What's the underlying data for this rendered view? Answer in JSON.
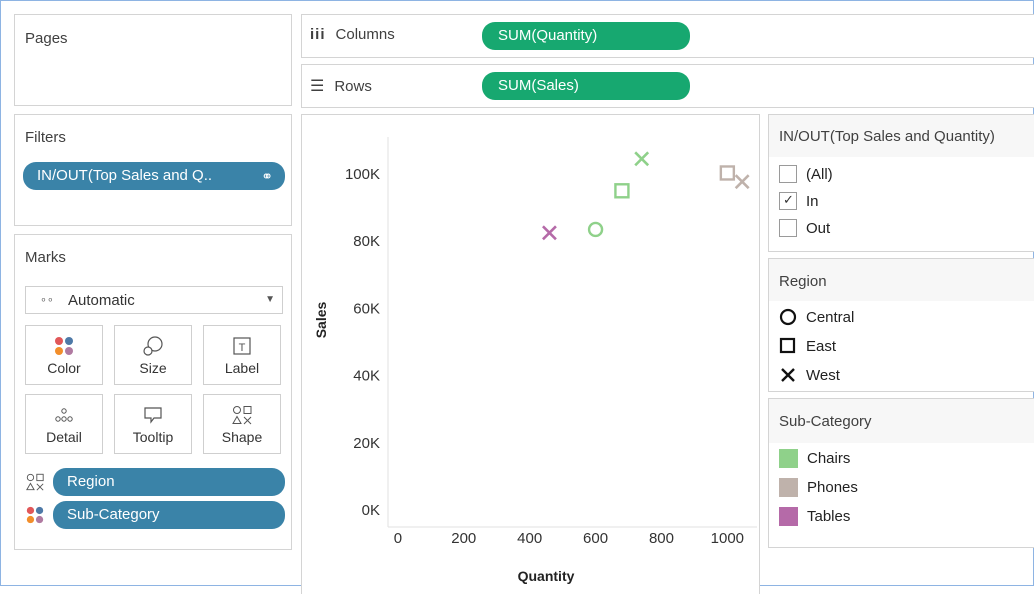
{
  "pages": {
    "title": "Pages"
  },
  "columns_shelf": {
    "label": "Columns",
    "pill": "SUM(Quantity)"
  },
  "rows_shelf": {
    "label": "Rows",
    "pill": "SUM(Sales)"
  },
  "filters": {
    "title": "Filters",
    "pill": "IN/OUT(Top Sales and Q.."
  },
  "marks": {
    "title": "Marks",
    "mark_type": "Automatic",
    "buttons": [
      {
        "label": "Color",
        "icon": "color-icon"
      },
      {
        "label": "Size",
        "icon": "size-icon"
      },
      {
        "label": "Label",
        "icon": "label-icon"
      },
      {
        "label": "Detail",
        "icon": "detail-icon"
      },
      {
        "label": "Tooltip",
        "icon": "tooltip-icon"
      },
      {
        "label": "Shape",
        "icon": "shape-icon"
      }
    ],
    "fields": [
      {
        "label": "Region",
        "icon": "shape-icon"
      },
      {
        "label": "Sub-Category",
        "icon": "color-icon"
      }
    ]
  },
  "inout_legend": {
    "title": "IN/OUT(Top Sales and Quantity)",
    "options": [
      {
        "label": "(All)",
        "checked": false
      },
      {
        "label": "In",
        "checked": true
      },
      {
        "label": "Out",
        "checked": false
      }
    ]
  },
  "region_legend": {
    "title": "Region",
    "items": [
      {
        "label": "Central",
        "shape": "circle"
      },
      {
        "label": "East",
        "shape": "square"
      },
      {
        "label": "West",
        "shape": "x"
      }
    ]
  },
  "subcategory_legend": {
    "title": "Sub-Category",
    "items": [
      {
        "label": "Chairs",
        "color": "#8fd18a"
      },
      {
        "label": "Phones",
        "color": "#bfb2ab"
      },
      {
        "label": "Tables",
        "color": "#b56aa8"
      }
    ]
  },
  "chart_data": {
    "type": "scatter",
    "xlabel": "Quantity",
    "ylabel": "Sales",
    "xlim": [
      -30,
      1090
    ],
    "ylim": [
      -5000,
      111000
    ],
    "x_ticks": [
      0,
      200,
      400,
      600,
      800,
      1000
    ],
    "x_tick_labels": [
      "0",
      "200",
      "400",
      "600",
      "800",
      "1000"
    ],
    "y_ticks": [
      0,
      20000,
      40000,
      60000,
      80000,
      100000
    ],
    "y_tick_labels": [
      "0K",
      "20K",
      "40K",
      "60K",
      "80K",
      "100K"
    ],
    "grid": false,
    "points": [
      {
        "region": "West",
        "sub_category": "Chairs",
        "x": 740,
        "y": 104500
      },
      {
        "region": "East",
        "sub_category": "Chairs",
        "x": 680,
        "y": 95000
      },
      {
        "region": "Central",
        "sub_category": "Chairs",
        "x": 600,
        "y": 83500
      },
      {
        "region": "West",
        "sub_category": "Tables",
        "x": 460,
        "y": 82500
      },
      {
        "region": "East",
        "sub_category": "Phones",
        "x": 1000,
        "y": 100300
      },
      {
        "region": "West",
        "sub_category": "Phones",
        "x": 1045,
        "y": 97700
      }
    ]
  }
}
